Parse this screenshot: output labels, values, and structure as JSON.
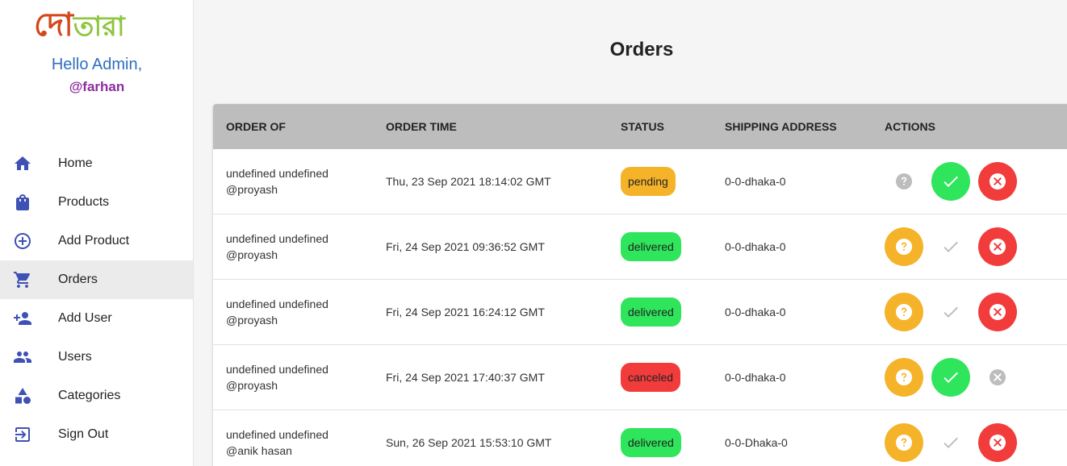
{
  "brand": {
    "logo_part1": "দো",
    "logo_part2": "তারা"
  },
  "greeting": {
    "hello": "Hello Admin,",
    "handle": "@farhan"
  },
  "nav": [
    {
      "label": "Home",
      "icon": "home-icon"
    },
    {
      "label": "Products",
      "icon": "shopping-bag-icon"
    },
    {
      "label": "Add Product",
      "icon": "add-circle-icon"
    },
    {
      "label": "Orders",
      "icon": "cart-icon",
      "active": true
    },
    {
      "label": "Add User",
      "icon": "person-add-icon"
    },
    {
      "label": "Users",
      "icon": "people-icon"
    },
    {
      "label": "Categories",
      "icon": "category-icon"
    },
    {
      "label": "Sign Out",
      "icon": "sign-out-icon"
    }
  ],
  "page": {
    "title": "Orders"
  },
  "table": {
    "headers": {
      "order_of": "Order Of",
      "order_time": "Order Time",
      "status": "Status",
      "shipping": "Shipping Address",
      "actions": "Actions"
    },
    "rows": [
      {
        "name": "undefined undefined",
        "user": "@proyash",
        "time": "Thu, 23 Sep 2021 18:14:02 GMT",
        "status": "pending",
        "address": "0-0-dhaka-0"
      },
      {
        "name": "undefined undefined",
        "user": "@proyash",
        "time": "Fri, 24 Sep 2021 09:36:52 GMT",
        "status": "delivered",
        "address": "0-0-dhaka-0"
      },
      {
        "name": "undefined undefined",
        "user": "@proyash",
        "time": "Fri, 24 Sep 2021 16:24:12 GMT",
        "status": "delivered",
        "address": "0-0-dhaka-0"
      },
      {
        "name": "undefined undefined",
        "user": "@proyash",
        "time": "Fri, 24 Sep 2021 17:40:37 GMT",
        "status": "canceled",
        "address": "0-0-dhaka-0"
      },
      {
        "name": "undefined undefined",
        "user": "@anik hasan",
        "time": "Sun, 26 Sep 2021 15:53:10 GMT",
        "status": "delivered",
        "address": "0-0-Dhaka-0"
      }
    ]
  },
  "colors": {
    "pending": "#f5b32a",
    "delivered": "#2ee55c",
    "canceled": "#f23c3c",
    "disabled": "#bdbdbd",
    "nav_icon": "#3f51b5"
  }
}
